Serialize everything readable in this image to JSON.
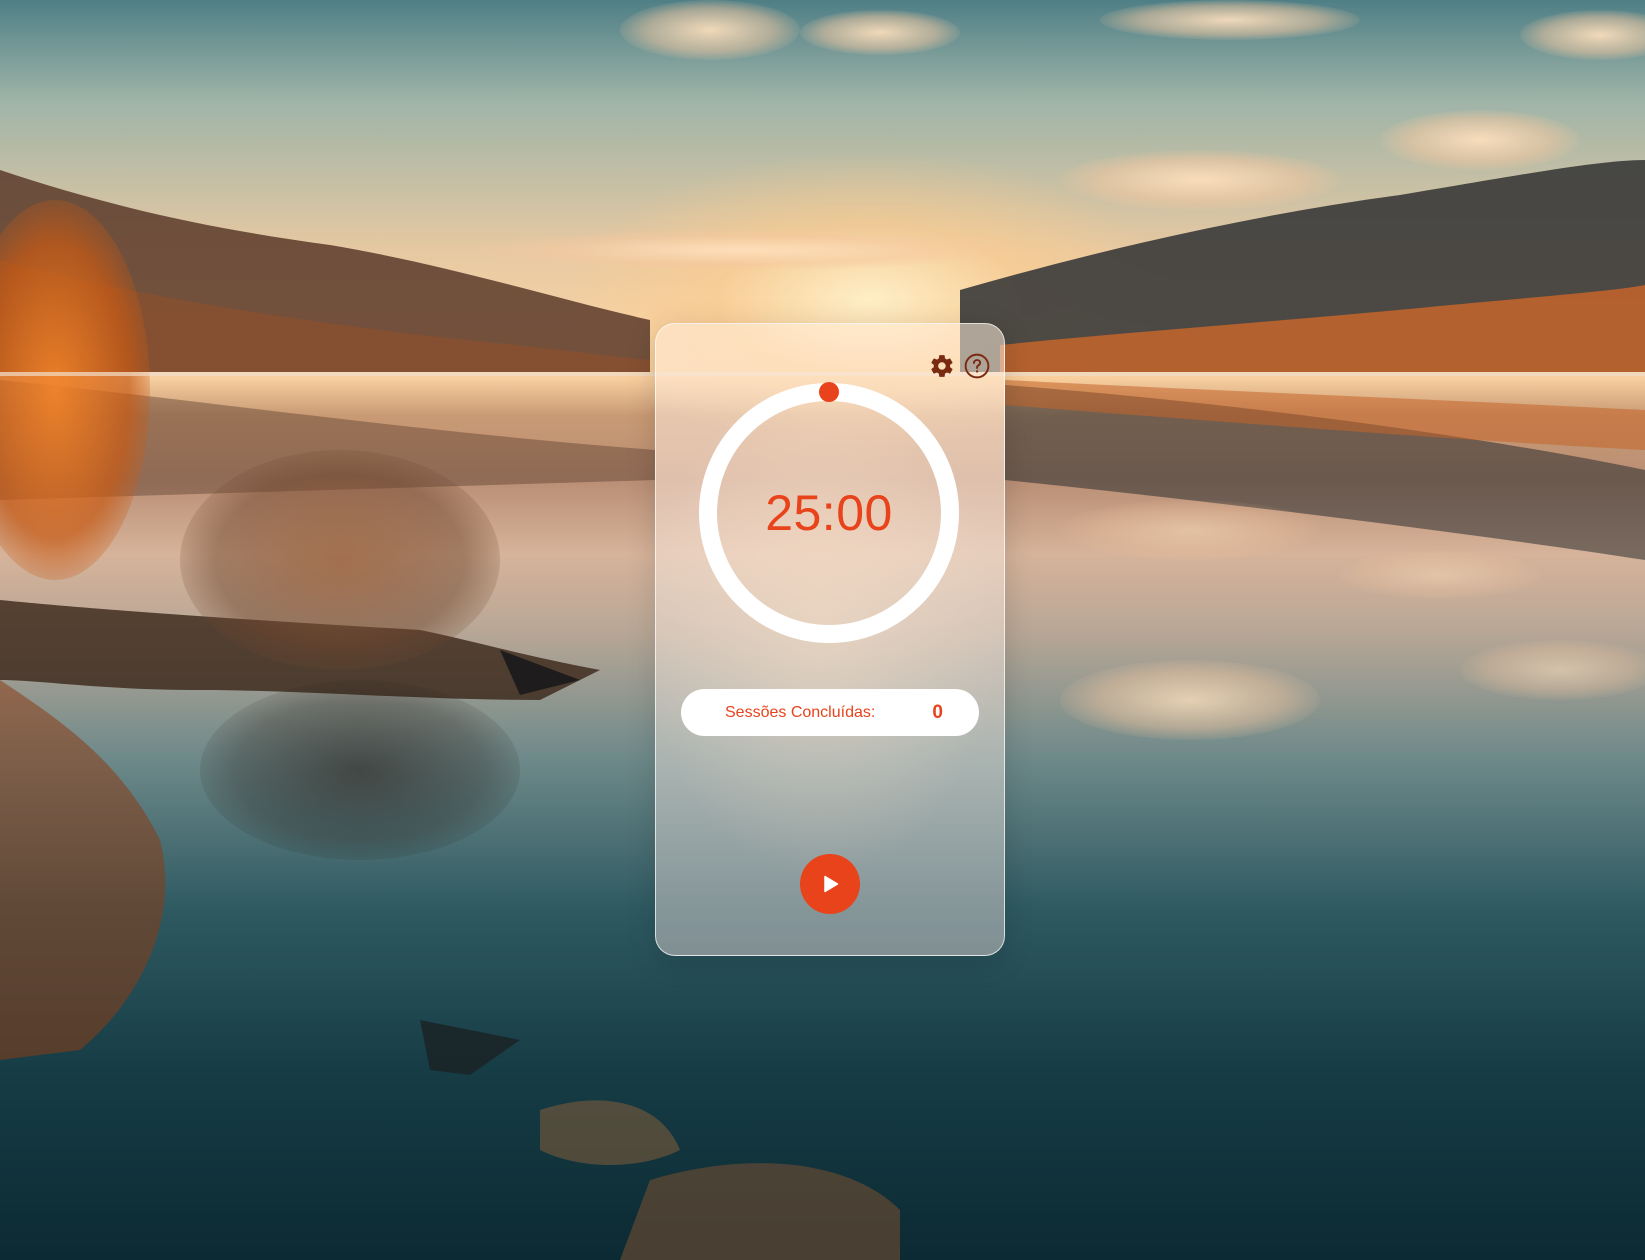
{
  "timer": {
    "display": "25:00",
    "progress": 0
  },
  "sessions": {
    "label": "Sessões Concluídas:",
    "count": "0"
  },
  "toolbar": {
    "settings_icon": "gear-icon",
    "help_icon": "question-circle-icon"
  },
  "controls": {
    "play_icon": "play-icon"
  },
  "colors": {
    "accent": "#e8431b",
    "ring": "#ffffff",
    "card_border": "#ffffff"
  }
}
